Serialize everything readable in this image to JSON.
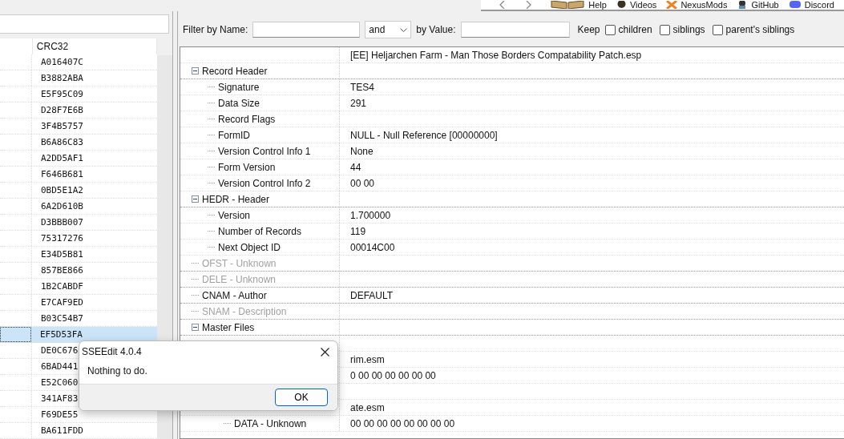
{
  "toolbar": {
    "links": [
      {
        "label": "Help"
      },
      {
        "label": "Videos"
      },
      {
        "label": "NexusMods"
      },
      {
        "label": "GitHub"
      },
      {
        "label": "Discord"
      }
    ]
  },
  "file_list": {
    "columns": [
      "CRC32"
    ],
    "rows": [
      {
        "crc": "A016407C",
        "selected": false
      },
      {
        "crc": "B3882ABA",
        "selected": false
      },
      {
        "crc": "E5F95C09",
        "selected": false
      },
      {
        "crc": "D28F7E6B",
        "selected": false
      },
      {
        "crc": "3F4B5757",
        "selected": false
      },
      {
        "crc": "B6A86C83",
        "selected": false
      },
      {
        "crc": "A2DD5AF1",
        "selected": false
      },
      {
        "crc": "F646B681",
        "selected": false
      },
      {
        "crc": "0BD5E1A2",
        "selected": false
      },
      {
        "crc": "6A2D610B",
        "selected": false
      },
      {
        "crc": "D3BBB007",
        "selected": false
      },
      {
        "crc": "75317276",
        "selected": false
      },
      {
        "crc": "E34D5B81",
        "selected": false
      },
      {
        "crc": "857BE866",
        "selected": false
      },
      {
        "crc": "1B2CABDF",
        "selected": false
      },
      {
        "crc": "E7CAF9ED",
        "selected": false
      },
      {
        "crc": "B03C54B7",
        "selected": false
      },
      {
        "crc": "EF5D53FA",
        "selected": true
      },
      {
        "crc": "DE0C676",
        "selected": false
      },
      {
        "crc": "6BAD441",
        "selected": false
      },
      {
        "crc": "E52C060",
        "selected": false
      },
      {
        "crc": "341AF83",
        "selected": false
      },
      {
        "crc": "F69DE55",
        "selected": false
      },
      {
        "crc": "BA611FDD",
        "selected": false
      }
    ]
  },
  "filter": {
    "name_label": "Filter by Name:",
    "operator": "and",
    "value_label": "by Value:",
    "keep_label": "Keep",
    "options": [
      {
        "label": "children",
        "checked": false
      },
      {
        "label": "siblings",
        "checked": false
      },
      {
        "label": "parent's siblings",
        "checked": false
      }
    ]
  },
  "record_tree": {
    "file_name": "[EE] Heljarchen Farm - Man Those Borders Compatability Patch.esp",
    "nodes": [
      {
        "name": "Record Header",
        "disabled": false,
        "expanded": true,
        "children": [
          {
            "name": "Signature",
            "value": "TES4"
          },
          {
            "name": "Data Size",
            "value": "291"
          },
          {
            "name": "Record Flags"
          },
          {
            "name": "FormID",
            "value": "NULL - Null Reference [00000000]"
          },
          {
            "name": "Version Control Info 1",
            "value": "None"
          },
          {
            "name": "Form Version",
            "value": "44"
          },
          {
            "name": "Version Control Info 2",
            "value": "00 00"
          }
        ]
      },
      {
        "name": "HEDR - Header",
        "disabled": false,
        "expanded": true,
        "children": [
          {
            "name": "Version",
            "value": "1.700000"
          },
          {
            "name": "Number of Records",
            "value": "119"
          },
          {
            "name": "Next Object ID",
            "value": "00014C00"
          }
        ]
      },
      {
        "name": "OFST - Unknown",
        "disabled": true
      },
      {
        "name": "DELE - Unknown",
        "disabled": true
      },
      {
        "name": "CNAM - Author",
        "disabled": false,
        "value": "DEFAULT"
      },
      {
        "name": "SNAM - Description",
        "disabled": true
      },
      {
        "name": "Master Files",
        "disabled": false,
        "expanded": true,
        "children": [
          {
            "children": [
              {
                "value": "rim.esm"
              },
              {
                "value": "0 00 00 00 00 00 00"
              }
            ]
          },
          {
            "children": [
              {
                "value": "ate.esm"
              },
              {
                "name": "DATA - Unknown",
                "value": "00 00 00 00 00 00 00 00"
              }
            ]
          }
        ]
      }
    ]
  },
  "dialog": {
    "title": "SSEEdit 4.0.4",
    "message": "Nothing to do.",
    "buttons": [
      "OK"
    ]
  }
}
